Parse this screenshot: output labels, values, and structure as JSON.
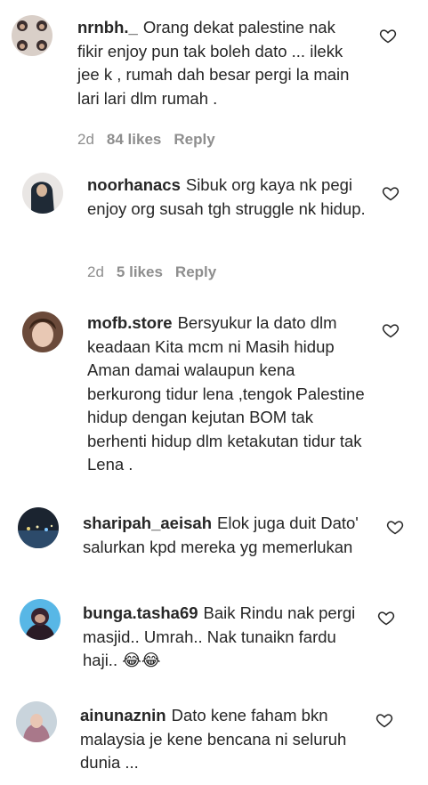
{
  "comments": [
    {
      "username": "nrnbh._",
      "text": "Orang dekat palestine nak fikir enjoy pun tak boleh dato ... ilekk jee k , rumah dah besar pergi la main lari lari dlm rumah .",
      "time": "2d",
      "likes": "84 likes",
      "reply": "Reply",
      "avatar_icon": "avatar-group-photo",
      "heart_icon": "heart-outline-icon"
    },
    {
      "username": "noorhanacs",
      "text": "Sibuk org kaya nk pegi enjoy org susah tgh struggle nk hidup.",
      "time": "2d",
      "likes": "5 likes",
      "reply": "Reply",
      "avatar_icon": "avatar-photo",
      "heart_icon": "heart-outline-icon"
    },
    {
      "username": "mofb.store",
      "text": "Bersyukur la dato dlm keadaan Kita mcm ni Masih hidup Aman damai walaupun kena berkurong tidur lena ,tengok Palestine hidup dengan kejutan BOM tak berhenti hidup dlm ketakutan tidur tak Lena .",
      "avatar_icon": "avatar-photo",
      "heart_icon": "heart-outline-icon"
    },
    {
      "username": "sharipah_aeisah",
      "text": "Elok juga duit Dato' salurkan kpd mereka yg memerlukan",
      "avatar_icon": "avatar-photo",
      "heart_icon": "heart-outline-icon"
    },
    {
      "username": "bunga.tasha69",
      "text": "Baik Rindu nak pergi masjid.. Umrah.. Nak tunaikn fardu haji.. 😂😂",
      "avatar_icon": "avatar-photo",
      "heart_icon": "heart-outline-icon"
    },
    {
      "username": "ainunaznin",
      "text": "Dato kene faham bkn malaysia je kene bencana ni seluruh dunia ...",
      "avatar_icon": "avatar-photo",
      "heart_icon": "heart-outline-icon"
    }
  ],
  "colors": {
    "text": "#262626",
    "meta": "#8e8e8e",
    "background": "#ffffff"
  }
}
